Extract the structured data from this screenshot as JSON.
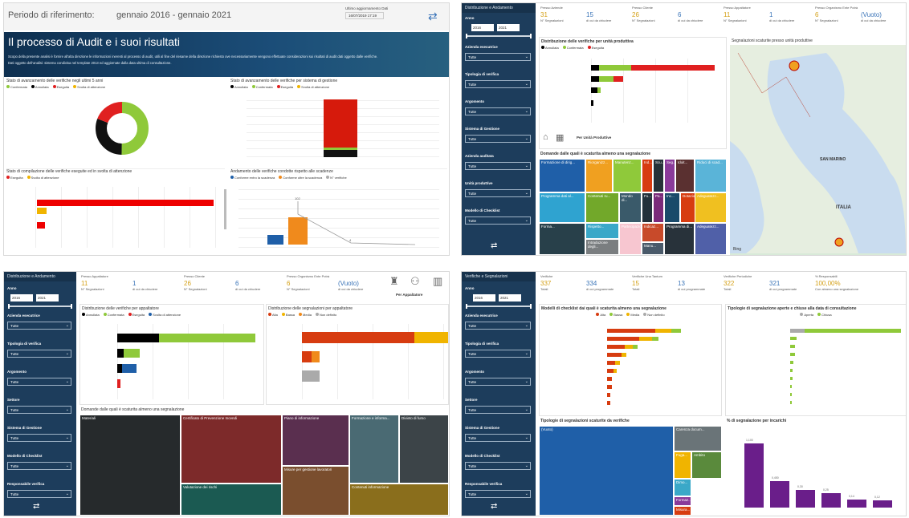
{
  "q1": {
    "period_label": "Periodo di riferimento:",
    "period_value": "gennaio 2016 - gennaio 2021",
    "last_update_label": "Ultimo aggiornamento Dati",
    "last_update_value": "16/07/2019 17:19",
    "title": "Il processo di Audit e i suoi risultati",
    "intro": "Scopo della presente analisi è fornire all'alta direzione le informazioni inerenti al processo di audit, utili al fine del riesame della direzione richiesto ove necessariamente vengono effettuate considerazioni sui risultati di audit dati oggetto dalle verifiche.",
    "intro2": "Dati oggetto dell'analisi: sistema condivisa nel template 2013 ed aggiornate dalla data ultima di consultazione.",
    "c1_title": "Stato di avanzamento delle verifiche negli ultimi 5 anni",
    "c1_legend": [
      "Confermata",
      "Annullata",
      "Eseguita",
      "Svolta di attenzione"
    ],
    "c2_title": "Stato di avanzamento delle verifiche per sistema di gestione",
    "c2_legend": [
      "Annullata",
      "Confermata",
      "Eseguita",
      "Svolta di attenzione"
    ],
    "c3_title": "Stato di compilazione delle verifiche eseguite ed in svolta di attenzione",
    "c3_legend": [
      "Eseguita",
      "Svolta di attenzione"
    ],
    "c4_title": "Andamento delle verifiche condotte rispetto alle scadenze",
    "c4_legend": [
      "Conforme entro la scadenza",
      "Conforme oltre la scadenza",
      "N° verifiche"
    ],
    "c4_value_top": "102",
    "c4_value_small": "4"
  },
  "q2": {
    "header": "Distribuzione e Andamento",
    "year_label": "Anno",
    "year_from": "2016",
    "year_to": "2021",
    "filters": [
      {
        "label": "Azienda esecutrice",
        "value": "Tutte"
      },
      {
        "label": "Tipologia di verifica",
        "value": "Tutte"
      },
      {
        "label": "Argomento",
        "value": "Tutte"
      },
      {
        "label": "Sistema di Gestione",
        "value": "Tutte"
      },
      {
        "label": "Azienda auditata",
        "value": "Tutte"
      },
      {
        "label": "Unità produttive",
        "value": "Tutte"
      },
      {
        "label": "Modello di Checklist",
        "value": "Tutte"
      }
    ],
    "kpi_groups": [
      {
        "title": "Presso Aziende",
        "a": "31",
        "a_lbl": "N° Segnalazioni",
        "b": "15",
        "b_lbl": "di cui da chiudere"
      },
      {
        "title": "Presso Cliente",
        "a": "26",
        "a_lbl": "N° Segnalazioni",
        "b": "6",
        "b_lbl": "di cui da chiudere"
      },
      {
        "title": "Presso Appaltatore",
        "a": "11",
        "a_lbl": "N° Segnalazioni",
        "b": "1",
        "b_lbl": "di cui da chiudere"
      },
      {
        "title": "Presso Organismo Ente Potrà",
        "a": "6",
        "a_lbl": "N° Segnalazioni",
        "b": "(Vuoto)",
        "b_lbl": "di cui da chiudere"
      }
    ],
    "bar_title": "Distribuzione delle verifiche per unità produttiva",
    "bar_legend": [
      "Annullata",
      "Confermata",
      "Eseguita"
    ],
    "bar_footer": "Per Unità Produttive",
    "treemap_title": "Domande dalle quali è scaturita almeno una segnalazione",
    "treemap": [
      "Formazione di dirig...",
      "Riorganizz...",
      "Manutenz...",
      "Ind...",
      "Scu...",
      "Seg...",
      "Idoit...",
      "Programma dati al...",
      "Contenuti ru...",
      "Mondo di...",
      "Fu...",
      "Pa...",
      "Inc...",
      "Partecipazio...",
      "Rispetto...",
      "Indicaz...",
      "Intraduzione degli...",
      "Riduci di scad...",
      "Dotazioni...",
      "Forma...",
      "Manu...",
      "Adeguatezz...",
      "Programma di...",
      "Adeguatezz..."
    ],
    "map_title": "Segnalazioni scaturite presso unità produttive",
    "map_labels": [
      "SAN MARINO",
      "ITALIA"
    ],
    "map_brand": "Bing"
  },
  "q3": {
    "header": "Distribuzione e Andamento",
    "year_label": "Anno",
    "year_from": "2016",
    "year_to": "2021",
    "filters": [
      {
        "label": "Azienda esecutrice",
        "value": "Tutte"
      },
      {
        "label": "Tipologia di verifica",
        "value": "Tutte"
      },
      {
        "label": "Argomento",
        "value": "Tutte"
      },
      {
        "label": "Settore",
        "value": "Tutte"
      },
      {
        "label": "Sistema di Gestione",
        "value": "Tutte"
      },
      {
        "label": "Modello di Checklist",
        "value": "Tutte"
      },
      {
        "label": "Responsabile verifica",
        "value": "Tutte"
      }
    ],
    "kpi_groups": [
      {
        "title": "Presso Appaltatore",
        "a": "11",
        "a_lbl": "N° Segnalazioni",
        "b": "1",
        "b_lbl": "di cui da chiudere"
      },
      {
        "title": "Presso Cliente",
        "a": "26",
        "a_lbl": "N° Segnalazioni",
        "b": "6",
        "b_lbl": "di cui da chiudere"
      },
      {
        "title": "Presso Organismo Ente Potrà",
        "a": "6",
        "a_lbl": "N° Segnalazioni",
        "b": "(Vuoto)",
        "b_lbl": "di cui da chiudere"
      }
    ],
    "nav_label": "Per Appaltatore",
    "left_title": "Distribuzione delle verifiche per appaltatore",
    "left_legend": [
      "Annullata",
      "Confermata",
      "Eseguita",
      "Svolta di attenzione"
    ],
    "right_title": "Distribuzione delle segnalazioni per appaltatore",
    "right_legend": [
      "Alta",
      "Bassa",
      "Media",
      "Non definito"
    ],
    "treemap_title": "Domande dalle quali è scaturita almeno una segnalazione",
    "treemap": [
      "Materiali",
      "Certificato di Prevenzione Incendi",
      "Piano di informazione",
      "Formazione e informa...",
      "Divieto di fumo",
      "Valutazione dei rischi",
      "Misure per gestione  lavoratori",
      "Contenuti informazione"
    ]
  },
  "q4": {
    "header": "Verifiche e Segnalazioni",
    "year_label": "Anno",
    "year_from": "2016",
    "year_to": "2021",
    "filters": [
      {
        "label": "Azienda esecutrice",
        "value": "Tutte"
      },
      {
        "label": "Tipologia di verifica",
        "value": "Tutte"
      },
      {
        "label": "Argomento",
        "value": "Tutte"
      },
      {
        "label": "Settore",
        "value": "Tutte"
      },
      {
        "label": "Sistema di Gestione",
        "value": "Tutte"
      },
      {
        "label": "Modello di Checklist",
        "value": "Tutte"
      },
      {
        "label": "Responsabile verifica",
        "value": "Tutte"
      }
    ],
    "kpi_groups": [
      {
        "title": "Verifiche",
        "a": "337",
        "a_lbl": "Totali",
        "b": "334",
        "b_lbl": "di cui programmate"
      },
      {
        "title": "Verifiche Una Tantum",
        "a": "15",
        "a_lbl": "Totali",
        "b": "13",
        "b_lbl": "di cui programmate"
      },
      {
        "title": "Verifiche Periodiche",
        "a": "322",
        "a_lbl": "Totali",
        "b": "321",
        "b_lbl": "di cui programmate"
      },
      {
        "title": "% Responsabili",
        "a": "100,00%",
        "a_lbl": "Con almeno una segnalazione",
        "b": "",
        "b_lbl": ""
      }
    ],
    "c1_title": "Modelli di checklist dai quali è scaturita almeno una segnalazione",
    "c1_legend": [
      "Alta",
      "Bassa",
      "Media",
      "Non definito"
    ],
    "c2_title": "Tipologie di segnalazione aperte e chiuse alla data di consultazione",
    "c2_legend": [
      "Aperta",
      "Chiusa"
    ],
    "c3_title": "Tipologie di segnalazioni scaturite da verifiche",
    "c3_cells": [
      "(Vuoto)",
      "Carenza docum...",
      "Fuga...",
      "Ambito",
      "Dimo...",
      "Formaz...",
      "Misura..."
    ],
    "c4_title": "% di segnalazione per incarichi",
    "c4_values": [
      "1,100",
      "0,450",
      "0,30",
      "0,25",
      "0,14",
      "0,12"
    ]
  }
}
